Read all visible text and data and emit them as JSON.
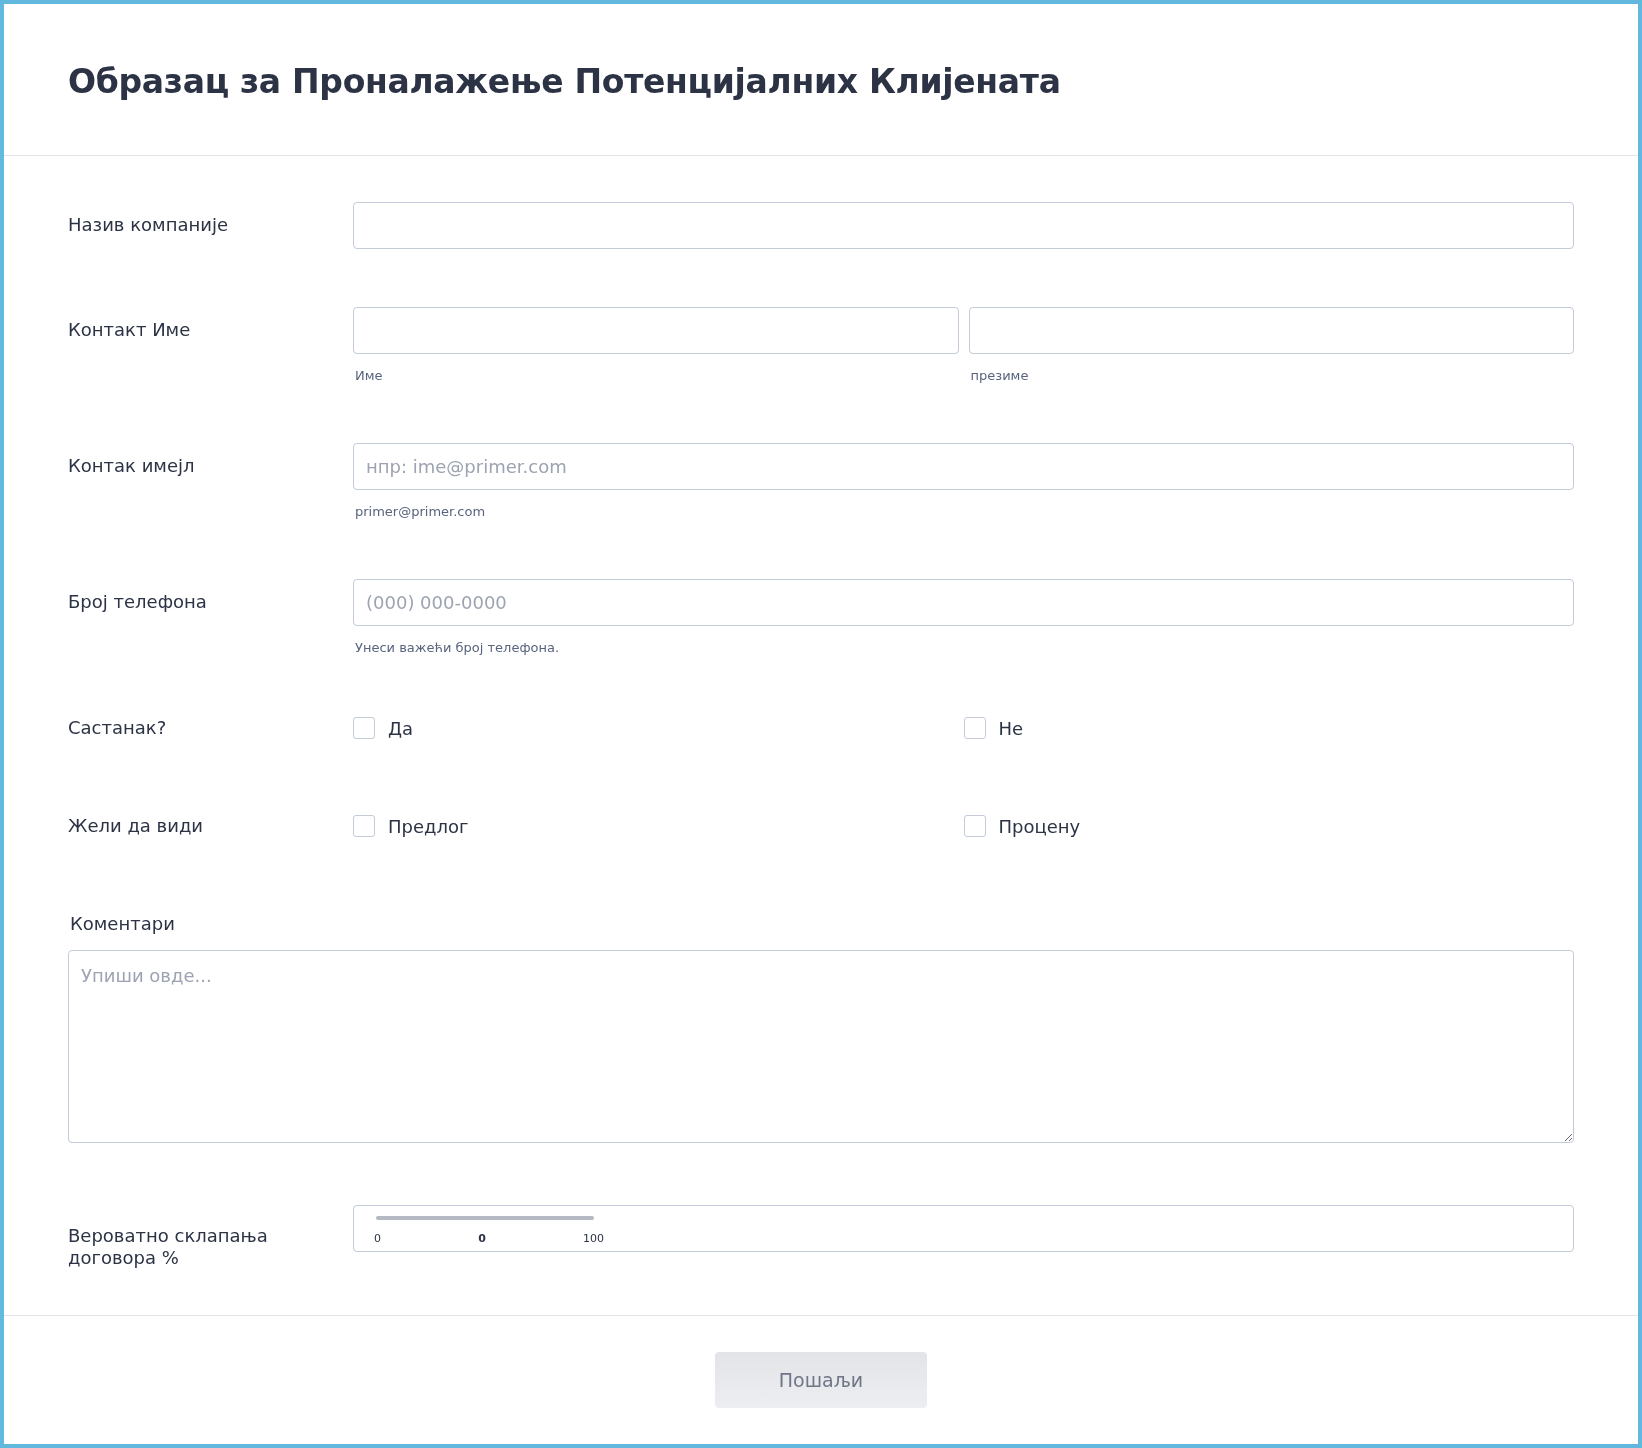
{
  "title": "Образац за Проналажење Потенцијалних Клијената",
  "fields": [
    {
      "kind": "text",
      "label": "Назив компаније"
    },
    {
      "kind": "name",
      "label": "Контакт Име",
      "inputs": [
        {
          "sublabel": "Име"
        },
        {
          "sublabel": "презиме"
        }
      ]
    },
    {
      "kind": "text",
      "label": "Контак имејл",
      "inputs": [
        {
          "placeholder": "нпр: ime@primer.com",
          "sublabel": "primer@primer.com"
        }
      ]
    },
    {
      "kind": "text",
      "label": "Број телефона",
      "inputs": [
        {
          "placeholder": "(000) 000-0000",
          "sublabel": "Унеси важећи број телефона."
        }
      ]
    },
    {
      "kind": "checks",
      "label": "Састанак?",
      "options": [
        {
          "label": "Да",
          "checked": false
        },
        {
          "label": "Не",
          "checked": false
        }
      ]
    },
    {
      "kind": "checks",
      "label": "Жели да види",
      "options": [
        {
          "label": "Предлог",
          "checked": false
        },
        {
          "label": "Процену",
          "checked": false
        }
      ]
    },
    {
      "kind": "textarea",
      "label": "Коментари",
      "placeholder": "Упиши овде..."
    },
    {
      "kind": "slider",
      "label": "Вероватно склапања договора %",
      "level": 0,
      "min": "0",
      "value": "0",
      "max": "100"
    }
  ],
  "submit": "Пошаљи"
}
